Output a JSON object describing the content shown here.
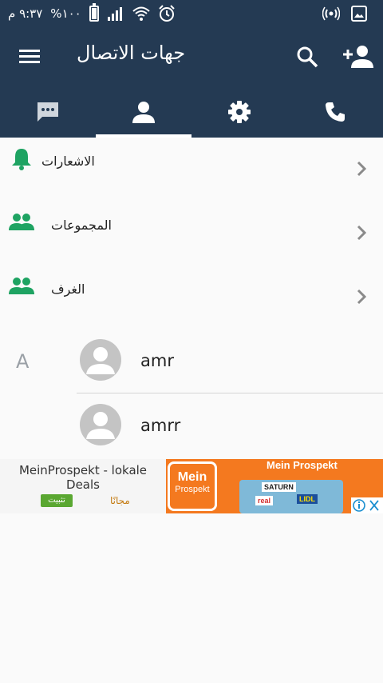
{
  "status_bar": {
    "time": "٩:٣٧ م",
    "battery": "%١٠٠"
  },
  "toolbar": {
    "title": "جهات الاتصال"
  },
  "tabs": [
    {
      "name": "calls",
      "icon": "phone-icon"
    },
    {
      "name": "settings",
      "icon": "gear-icon"
    },
    {
      "name": "contacts",
      "icon": "person-icon",
      "selected": true
    },
    {
      "name": "messages",
      "icon": "chat-icon"
    }
  ],
  "menu_items": [
    {
      "label": "الاشعارات",
      "icon": "bell-icon"
    },
    {
      "label": "المجموعات",
      "icon": "group-icon"
    },
    {
      "label": "الغرف",
      "icon": "group-icon"
    }
  ],
  "contacts": {
    "section_letter": "A",
    "items": [
      {
        "name": "amr"
      },
      {
        "name": "amrr"
      }
    ]
  },
  "ad": {
    "title": "MeinProspekt - lokale Deals",
    "install_label": "تثبيت",
    "free_label": "مجانًا",
    "logo_line1": "Mein",
    "logo_line2": "Prospekt",
    "tagline": "Mein Prospekt",
    "stores": [
      "SATURN",
      "real",
      "LIDL"
    ]
  },
  "colors": {
    "header": "#243a53",
    "accent_green": "#1ea362",
    "ad_orange": "#f4791f"
  }
}
